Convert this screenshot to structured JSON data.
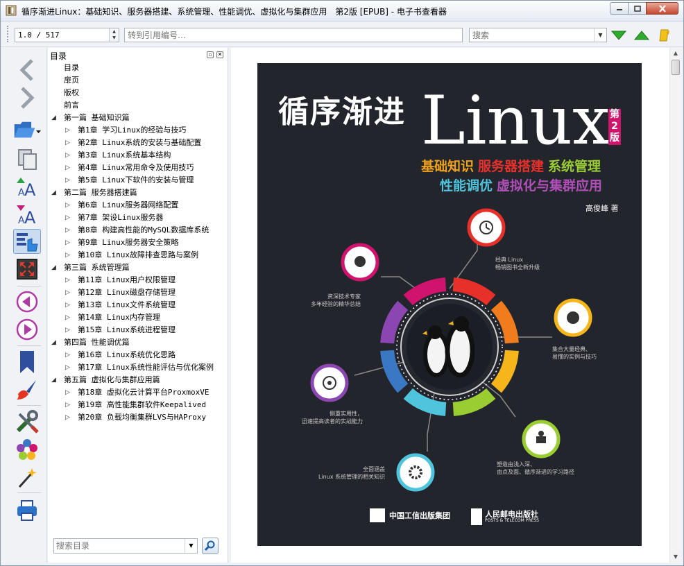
{
  "window": {
    "title": "循序渐进Linux：基础知识、服务器搭建、系统管理、性能调优、虚拟化与集群应用　第2版 [EPUB] - 电子书查看器"
  },
  "toolbar": {
    "page_value": "1.0 / 517",
    "cite_placeholder": "转到引用编号…",
    "search_placeholder": "搜索"
  },
  "sidebar": {
    "icons": [
      "back-icon",
      "forward-icon",
      "open-book-icon",
      "copy-icon",
      "font-larger-icon",
      "font-smaller-icon",
      "toc-icon",
      "fullscreen-icon",
      "previous-page-icon",
      "next-page-icon",
      "bookmark-icon",
      "paintbrush-icon",
      "tools-icon",
      "preferences-icon",
      "magic-wand-icon",
      "print-icon"
    ]
  },
  "toc": {
    "header": "目录",
    "search_placeholder": "搜索目录",
    "items": [
      {
        "label": "目录",
        "level": 0,
        "expanded": null
      },
      {
        "label": "扉页",
        "level": 0,
        "expanded": null
      },
      {
        "label": "版权",
        "level": 0,
        "expanded": null
      },
      {
        "label": "前言",
        "level": 0,
        "expanded": null
      },
      {
        "label": "第一篇 基础知识篇",
        "level": 0,
        "expanded": true
      },
      {
        "label": "第1章 学习Linux的经验与技巧",
        "level": 1,
        "expanded": false
      },
      {
        "label": "第2章 Linux系统的安装与基础配置",
        "level": 1,
        "expanded": false
      },
      {
        "label": "第3章 Linux系统基本结构",
        "level": 1,
        "expanded": false
      },
      {
        "label": "第4章 Linux常用命令及使用技巧",
        "level": 1,
        "expanded": false
      },
      {
        "label": "第5章 Linux下软件的安装与管理",
        "level": 1,
        "expanded": false
      },
      {
        "label": "第二篇 服务器搭建篇",
        "level": 0,
        "expanded": true
      },
      {
        "label": "第6章 Linux服务器网络配置",
        "level": 1,
        "expanded": false
      },
      {
        "label": "第7章 架设Linux服务器",
        "level": 1,
        "expanded": false
      },
      {
        "label": "第8章 构建高性能的MySQL数据库系统",
        "level": 1,
        "expanded": false
      },
      {
        "label": "第9章 Linux服务器安全策略",
        "level": 1,
        "expanded": false
      },
      {
        "label": "第10章 Linux故障排查思路与案例",
        "level": 1,
        "expanded": false
      },
      {
        "label": "第三篇 系统管理篇",
        "level": 0,
        "expanded": true
      },
      {
        "label": "第11章 Linux用户权限管理",
        "level": 1,
        "expanded": false
      },
      {
        "label": "第12章 Linux磁盘存储管理",
        "level": 1,
        "expanded": false
      },
      {
        "label": "第13章 Linux文件系统管理",
        "level": 1,
        "expanded": false
      },
      {
        "label": "第14章 Linux内存管理",
        "level": 1,
        "expanded": false
      },
      {
        "label": "第15章 Linux系统进程管理",
        "level": 1,
        "expanded": false
      },
      {
        "label": "第四篇 性能调优篇",
        "level": 0,
        "expanded": true
      },
      {
        "label": "第16章 Linux系统优化思路",
        "level": 1,
        "expanded": false
      },
      {
        "label": "第17章 Linux系统性能评估与优化案例",
        "level": 1,
        "expanded": false
      },
      {
        "label": "第五篇 虚拟化与集群应用篇",
        "level": 0,
        "expanded": true
      },
      {
        "label": "第18章 虚拟化云计算平台ProxmoxVE",
        "level": 1,
        "expanded": false
      },
      {
        "label": "第19章 高性能集群软件Keepalived",
        "level": 1,
        "expanded": false
      },
      {
        "label": "第20章 负载均衡集群LVS与HAProxy",
        "level": 1,
        "expanded": false
      }
    ]
  },
  "cover": {
    "title_cn": "循序渐进",
    "title_en": "Linux",
    "edition": "第2版",
    "subtitle_line1": [
      {
        "text": "基础知识",
        "color": "#f0a21c"
      },
      {
        "text": "服务器搭建",
        "color": "#e8302a"
      },
      {
        "text": "系统管理",
        "color": "#9acd32"
      }
    ],
    "subtitle_line2": [
      {
        "text": "性能调优",
        "color": "#4fc4dc"
      },
      {
        "text": "虚拟化与集群应用",
        "color": "#b04fb8"
      }
    ],
    "author": "高俊峰 著",
    "notes": {
      "classic": [
        "经典 Linux",
        "畅销图书全新升级"
      ],
      "expert": [
        "资深技术专家",
        "多年经验的精华总结"
      ],
      "cases": [
        "集合大量经典、",
        "易懂的实例与技巧"
      ],
      "practical": [
        "侧重实用性，",
        "迅速提高读者的实战能力"
      ],
      "coverage": [
        "全面涵盖",
        "Linux 系统管理的相关知识"
      ],
      "path": [
        "塑造由浅入深、",
        "由点及面、循序渐进的学习路径"
      ]
    },
    "publisher1": "中国工信出版集团",
    "publisher2": "人民邮电出版社",
    "publisher2_en": "POSTS & TELECOM PRESS",
    "ring_colors": [
      "#e8302a",
      "#f07c1e",
      "#f5b51b",
      "#9acd32",
      "#4fc4dc",
      "#3b78c4",
      "#8b46b2",
      "#d0136d"
    ]
  }
}
